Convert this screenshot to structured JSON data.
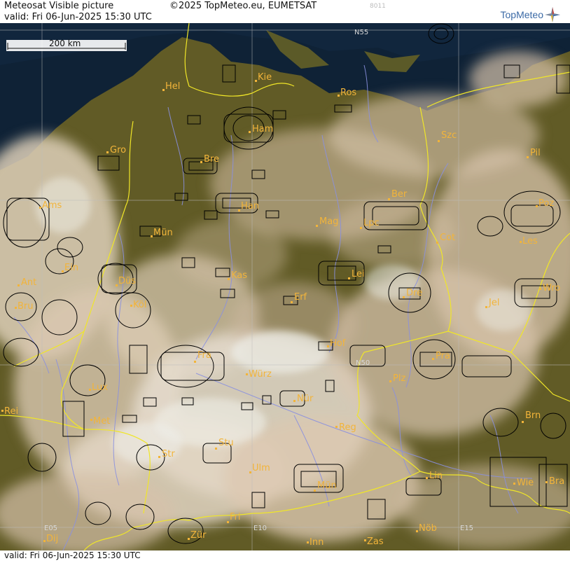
{
  "header": {
    "title": "Meteosat Visible picture",
    "valid": "valid:  Fri  06-Jun-2025  15:30 UTC",
    "copyright": "©2025 TopMeteo.eu, EUMETSAT",
    "code": "8011",
    "brand": "TopMeteo"
  },
  "footer": {
    "valid": "valid:  Fri  06-Jun-2025  15:30 UTC"
  },
  "scale": {
    "label": "200 km"
  },
  "grid_labels": [
    {
      "id": "n55",
      "text": "N55"
    },
    {
      "id": "n50",
      "text": "N50"
    },
    {
      "id": "e05",
      "text": "E05"
    },
    {
      "id": "e10",
      "text": "E10"
    },
    {
      "id": "e15",
      "text": "E15"
    }
  ],
  "cities": [
    {
      "name": "Hel"
    },
    {
      "name": "Kie"
    },
    {
      "name": "Ros"
    },
    {
      "name": "Ham"
    },
    {
      "name": "Szc"
    },
    {
      "name": "Gro"
    },
    {
      "name": "Bre"
    },
    {
      "name": "Pil"
    },
    {
      "name": "Ams"
    },
    {
      "name": "Han"
    },
    {
      "name": "Ber"
    },
    {
      "name": "Poz"
    },
    {
      "name": "Mag"
    },
    {
      "name": "Lpc"
    },
    {
      "name": "Mün"
    },
    {
      "name": "Cot"
    },
    {
      "name": "Les"
    },
    {
      "name": "Ein"
    },
    {
      "name": "Kas"
    },
    {
      "name": "Lei"
    },
    {
      "name": "Ant"
    },
    {
      "name": "Düs"
    },
    {
      "name": "Dre"
    },
    {
      "name": "Wro"
    },
    {
      "name": "Bru"
    },
    {
      "name": "Köl"
    },
    {
      "name": "Erf"
    },
    {
      "name": "Jel"
    },
    {
      "name": "Hof"
    },
    {
      "name": "Fra"
    },
    {
      "name": "Pra"
    },
    {
      "name": "Würz"
    },
    {
      "name": "Plz"
    },
    {
      "name": "Lux"
    },
    {
      "name": "Nür"
    },
    {
      "name": "Rei"
    },
    {
      "name": "Met"
    },
    {
      "name": "Reg"
    },
    {
      "name": "Brn"
    },
    {
      "name": "Stu"
    },
    {
      "name": "Str"
    },
    {
      "name": "Ulm"
    },
    {
      "name": "Lin"
    },
    {
      "name": "Mün"
    },
    {
      "name": "Wie"
    },
    {
      "name": "Bra"
    },
    {
      "name": "Fri"
    },
    {
      "name": "Zür"
    },
    {
      "name": "Nöb"
    },
    {
      "name": "Dij"
    },
    {
      "name": "Inn"
    },
    {
      "name": "Zas"
    }
  ],
  "colors": {
    "sea": "#0f2236",
    "land": "#5f5a24",
    "cloud": "#e7d7c2",
    "border": "#f0e628",
    "river": "#8a90e0",
    "city": "#f2b43a",
    "airspace": "#000000"
  },
  "icons": {
    "brand": "compass-star-icon"
  }
}
